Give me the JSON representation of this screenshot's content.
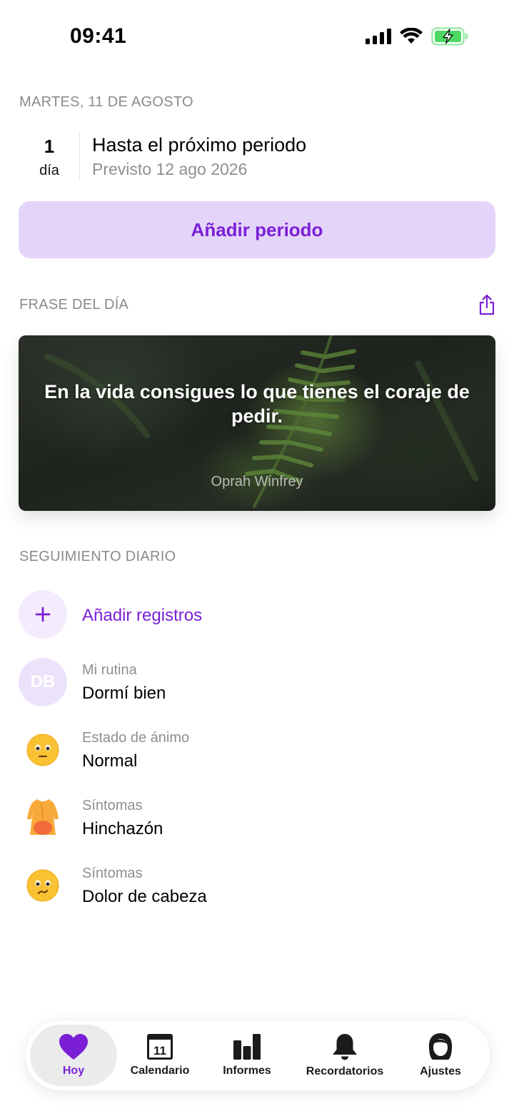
{
  "status_bar": {
    "time": "09:41"
  },
  "today": {
    "date_label": "MARTES, 11 DE AGOSTO",
    "countdown_number": "1",
    "countdown_unit": "día",
    "countdown_title": "Hasta el próximo periodo",
    "countdown_subtitle": "Previsto 12 ago 2026",
    "add_period_label": "Añadir periodo"
  },
  "quote": {
    "section_label": "FRASE DEL DÍA",
    "text": "En la vida consigues lo que tienes el coraje de pedir.",
    "author": "Oprah Winfrey"
  },
  "tracking": {
    "section_label": "SEGUIMIENTO DIARIO",
    "add_label": "Añadir registros",
    "items": [
      {
        "avatar_text": "DB",
        "icon": "routine-avatar",
        "label": "Mi rutina",
        "value": "Dormí bien"
      },
      {
        "icon": "neutral-face-icon",
        "label": "Estado de ánimo",
        "value": "Normal"
      },
      {
        "icon": "bloating-icon",
        "label": "Síntomas",
        "value": "Hinchazón"
      },
      {
        "icon": "headache-face-icon",
        "label": "Síntomas",
        "value": "Dolor de cabeza"
      }
    ]
  },
  "tabs": [
    {
      "label": "Hoy",
      "icon": "heart-icon",
      "active": true
    },
    {
      "label": "Calendario",
      "icon": "calendar-icon",
      "calendar_day": "11"
    },
    {
      "label": "Informes",
      "icon": "bar-chart-icon"
    },
    {
      "label": "Recordatorios",
      "icon": "bell-icon"
    },
    {
      "label": "Ajustes",
      "icon": "profile-icon"
    }
  ],
  "colors": {
    "accent": "#7a1fd6",
    "accent_light": "#e5d4fa",
    "secondary_text": "#8e8e93",
    "battery_green": "#4cd964"
  }
}
